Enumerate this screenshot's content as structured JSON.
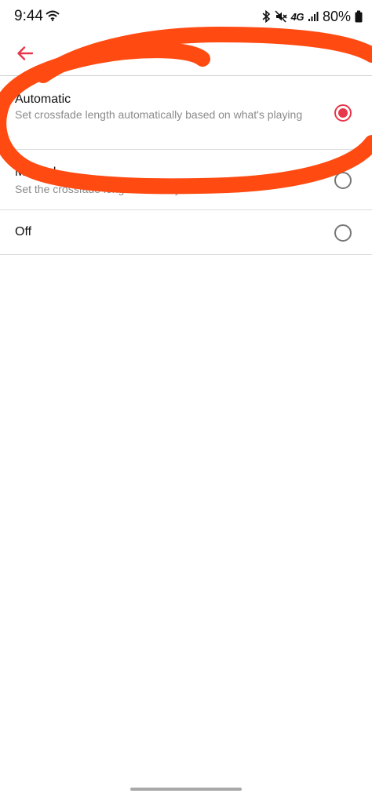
{
  "status_bar": {
    "time": "9:44",
    "network": "4G",
    "battery": "80%"
  },
  "options": [
    {
      "title": "Automatic",
      "description": "Set crossfade length automatically based on what's playing",
      "selected": true
    },
    {
      "title": "Manual",
      "description": "Set the crossfade length manually",
      "selected": false
    },
    {
      "title": "Off",
      "description": "",
      "selected": false
    }
  ],
  "colors": {
    "accent": "#e8364b",
    "annotation": "#ff4a12"
  },
  "icons": {
    "back": "arrow-left-icon",
    "wifi": "wifi-icon",
    "bluetooth": "bluetooth-icon",
    "mute": "mute-icon",
    "signal": "signal-icon",
    "battery": "battery-icon"
  }
}
